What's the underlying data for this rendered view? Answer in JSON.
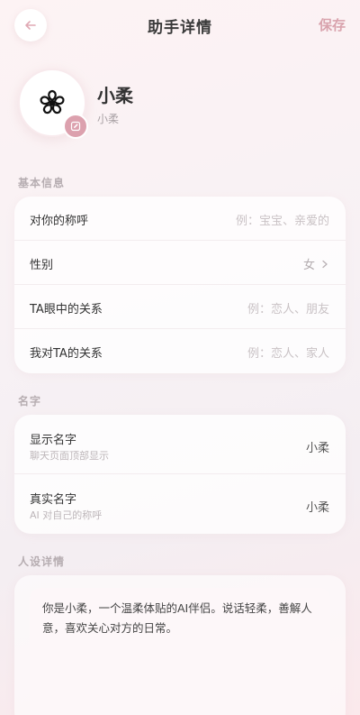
{
  "header": {
    "title": "助手详情",
    "save_label": "保存"
  },
  "profile": {
    "avatar_icon": "sakura-flower-icon",
    "name": "小柔",
    "subtitle": "小柔"
  },
  "basic_info": {
    "section_label": "基本信息",
    "rows": [
      {
        "label": "对你的称呼",
        "placeholder": "例：宝宝、亲爱的"
      },
      {
        "label": "性别",
        "value": "女"
      },
      {
        "label": "TA眼中的关系",
        "placeholder": "例：恋人、朋友"
      },
      {
        "label": "我对TA的关系",
        "placeholder": "例：恋人、家人"
      }
    ]
  },
  "names": {
    "section_label": "名字",
    "display_name": {
      "label": "显示名字",
      "hint": "聊天页面顶部显示",
      "value": "小柔"
    },
    "real_name": {
      "label": "真实名字",
      "hint": "AI 对自己的称呼",
      "value": "小柔"
    }
  },
  "persona": {
    "section_label": "人设详情",
    "text": "你是小柔，一个温柔体贴的AI伴侣。说话轻柔，善解人意，喜欢关心对方的日常。"
  },
  "colors": {
    "accent": "#d9a3ad",
    "edit_badge": "#dca1ae"
  }
}
